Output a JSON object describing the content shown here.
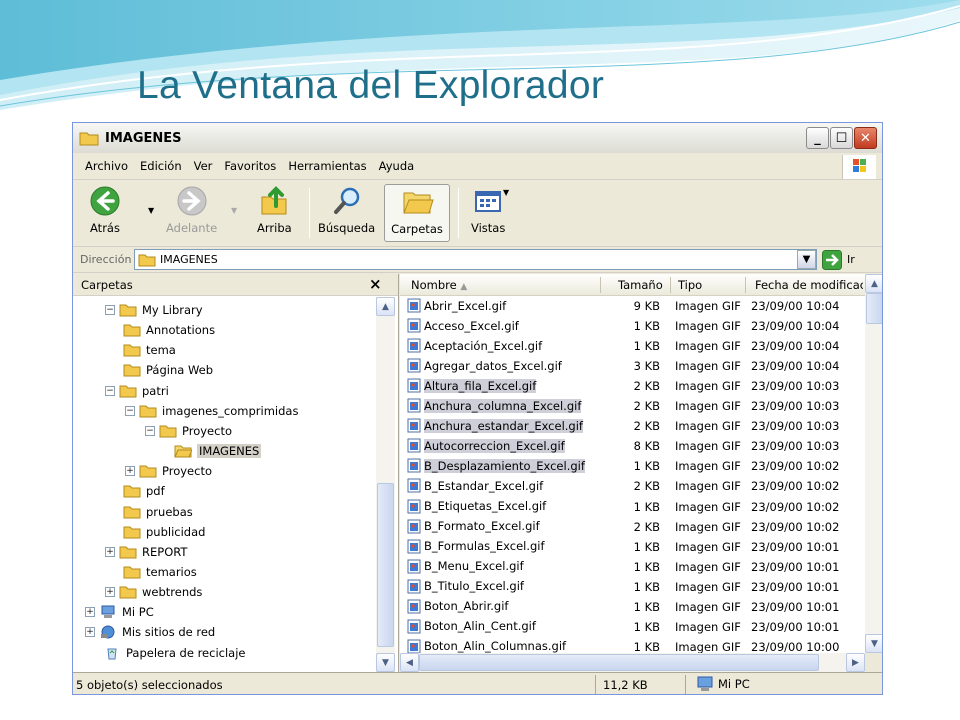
{
  "slide": {
    "title": "La Ventana del Explorador"
  },
  "window": {
    "title": "IMAGENES",
    "menu": [
      "Archivo",
      "Edición",
      "Ver",
      "Favoritos",
      "Herramientas",
      "Ayuda"
    ],
    "toolbar": {
      "back": "Atrás",
      "forward": "Adelante",
      "up": "Arriba",
      "search": "Búsqueda",
      "folders": "Carpetas",
      "views": "Vistas"
    },
    "address": {
      "label": "Dirección",
      "value": "IMAGENES",
      "go": "Ir"
    },
    "folders_pane": {
      "title": "Carpetas",
      "items": [
        {
          "label": "My Library",
          "toggle": "⊟"
        },
        {
          "label": "Annotations",
          "toggle": ""
        },
        {
          "label": "tema",
          "toggle": ""
        },
        {
          "label": "Página Web",
          "toggle": ""
        },
        {
          "label": "patri",
          "toggle": "⊟"
        },
        {
          "label": "imagenes_comprimidas",
          "toggle": "⊟"
        },
        {
          "label": "Proyecto",
          "toggle": "⊟"
        },
        {
          "label": "IMAGENES",
          "toggle": ""
        },
        {
          "label": "Proyecto",
          "toggle": "⊞"
        },
        {
          "label": "pdf",
          "toggle": ""
        },
        {
          "label": "pruebas",
          "toggle": ""
        },
        {
          "label": "publicidad",
          "toggle": ""
        },
        {
          "label": "REPORT",
          "toggle": "⊞"
        },
        {
          "label": "temarios",
          "toggle": ""
        },
        {
          "label": "webtrends",
          "toggle": "⊞"
        },
        {
          "label": "Mi PC",
          "toggle": "⊞"
        },
        {
          "label": "Mis sitios de red",
          "toggle": "⊞"
        },
        {
          "label": "Papelera de reciclaje",
          "toggle": ""
        }
      ]
    },
    "columns": {
      "name": "Nombre",
      "size": "Tamaño",
      "type": "Tipo",
      "date": "Fecha de modificación"
    },
    "files": [
      {
        "name": "Abrir_Excel.gif",
        "size": "9 KB",
        "type": "Imagen GIF",
        "date": "23/09/00 10:04",
        "selected": false
      },
      {
        "name": "Acceso_Excel.gif",
        "size": "1 KB",
        "type": "Imagen GIF",
        "date": "23/09/00 10:04",
        "selected": false
      },
      {
        "name": "Aceptación_Excel.gif",
        "size": "1 KB",
        "type": "Imagen GIF",
        "date": "23/09/00 10:04",
        "selected": false
      },
      {
        "name": "Agregar_datos_Excel.gif",
        "size": "3 KB",
        "type": "Imagen GIF",
        "date": "23/09/00 10:04",
        "selected": false
      },
      {
        "name": "Altura_fila_Excel.gif",
        "size": "2 KB",
        "type": "Imagen GIF",
        "date": "23/09/00 10:03",
        "selected": true
      },
      {
        "name": "Anchura_columna_Excel.gif",
        "size": "2 KB",
        "type": "Imagen GIF",
        "date": "23/09/00 10:03",
        "selected": true
      },
      {
        "name": "Anchura_estandar_Excel.gif",
        "size": "2 KB",
        "type": "Imagen GIF",
        "date": "23/09/00 10:03",
        "selected": true
      },
      {
        "name": "Autocorreccion_Excel.gif",
        "size": "8 KB",
        "type": "Imagen GIF",
        "date": "23/09/00 10:03",
        "selected": true
      },
      {
        "name": "B_Desplazamiento_Excel.gif",
        "size": "1 KB",
        "type": "Imagen GIF",
        "date": "23/09/00 10:02",
        "selected": true
      },
      {
        "name": "B_Estandar_Excel.gif",
        "size": "2 KB",
        "type": "Imagen GIF",
        "date": "23/09/00 10:02",
        "selected": false
      },
      {
        "name": "B_Etiquetas_Excel.gif",
        "size": "1 KB",
        "type": "Imagen GIF",
        "date": "23/09/00 10:02",
        "selected": false
      },
      {
        "name": "B_Formato_Excel.gif",
        "size": "2 KB",
        "type": "Imagen GIF",
        "date": "23/09/00 10:02",
        "selected": false
      },
      {
        "name": "B_Formulas_Excel.gif",
        "size": "1 KB",
        "type": "Imagen GIF",
        "date": "23/09/00 10:01",
        "selected": false
      },
      {
        "name": "B_Menu_Excel.gif",
        "size": "1 KB",
        "type": "Imagen GIF",
        "date": "23/09/00 10:01",
        "selected": false
      },
      {
        "name": "B_Titulo_Excel.gif",
        "size": "1 KB",
        "type": "Imagen GIF",
        "date": "23/09/00 10:01",
        "selected": false
      },
      {
        "name": "Boton_Abrir.gif",
        "size": "1 KB",
        "type": "Imagen GIF",
        "date": "23/09/00 10:01",
        "selected": false
      },
      {
        "name": "Boton_Alin_Cent.gif",
        "size": "1 KB",
        "type": "Imagen GIF",
        "date": "23/09/00 10:01",
        "selected": false
      },
      {
        "name": "Boton_Alin_Columnas.gif",
        "size": "1 KB",
        "type": "Imagen GIF",
        "date": "23/09/00 10:00",
        "selected": false
      }
    ],
    "status": {
      "selection": "5 objeto(s) seleccionados",
      "size": "11,2 KB",
      "location": "Mi PC"
    }
  }
}
